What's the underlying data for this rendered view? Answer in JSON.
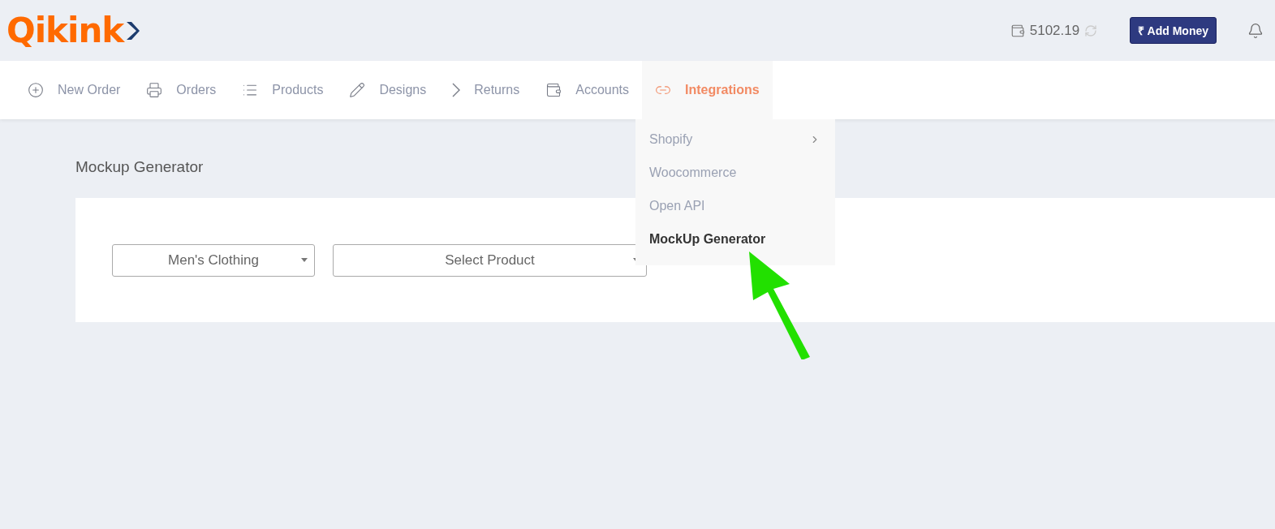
{
  "header": {
    "logo": "Qikink",
    "balance": "5102.19",
    "add_money_button": "₹ Add Money"
  },
  "nav": [
    {
      "label": "New Order",
      "selected": false
    },
    {
      "label": "Orders",
      "selected": false
    },
    {
      "label": "Products",
      "selected": false
    },
    {
      "label": "Designs",
      "selected": false
    },
    {
      "label": "Returns",
      "selected": false
    },
    {
      "label": "Accounts",
      "selected": false
    },
    {
      "label": "Integrations",
      "selected": true
    }
  ],
  "dropdown": [
    {
      "label": "Shopify",
      "has_submenu": true,
      "selected": false
    },
    {
      "label": "Woocommerce",
      "has_submenu": false,
      "selected": false
    },
    {
      "label": "Open API",
      "has_submenu": false,
      "selected": false
    },
    {
      "label": "MockUp Generator",
      "has_submenu": false,
      "selected": true
    }
  ],
  "page": {
    "title": "Mockup Generator",
    "selects": [
      {
        "value": "Men's Clothing"
      },
      {
        "value": "Select Product"
      }
    ]
  }
}
